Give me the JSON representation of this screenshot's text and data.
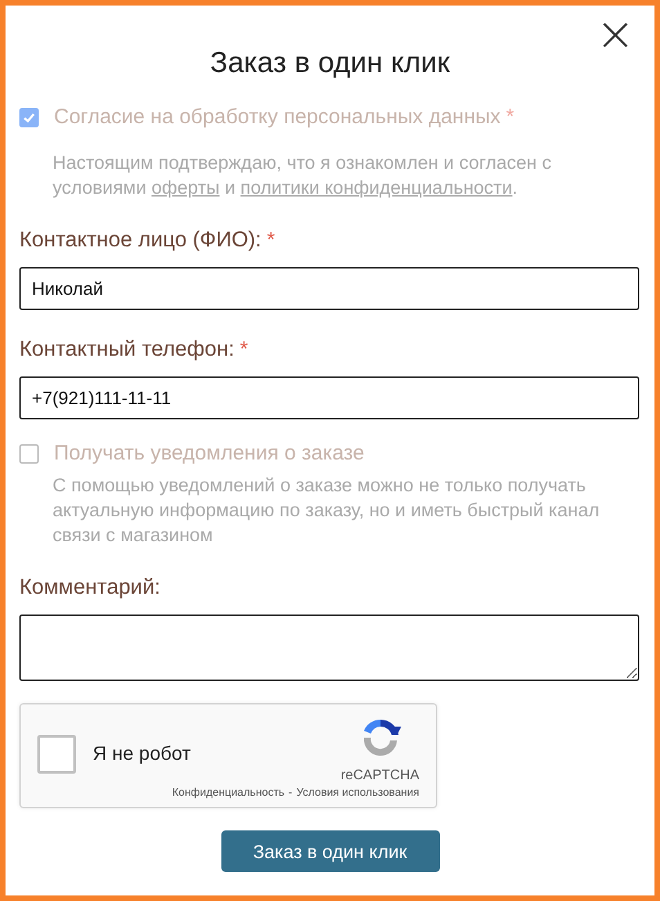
{
  "dialog": {
    "title": "Заказ в один клик",
    "close": "×"
  },
  "consent": {
    "checked": true,
    "label": "Согласие на обработку персональных данных",
    "required": "*",
    "text_before": "Настоящим подтверждаю, что я ознакомлен и согласен с условиями ",
    "link_1": "оферты",
    "text_middle": " и ",
    "link_2": "политики конфиденциальности",
    "text_after": "."
  },
  "fields": [
    {
      "label": "Контактное лицо (ФИО):",
      "required": "*",
      "value": "Николай",
      "kind": "input"
    },
    {
      "label": "Контактный телефон:",
      "required": "*",
      "value": "+7(921)111-11-11",
      "kind": "input"
    }
  ],
  "notifications": {
    "checked": false,
    "label": "Получать уведомления о заказе",
    "description": "С помощью уведомлений о заказе можно не только получать актуальную информацию по заказу, но и иметь быстрый канал связи с магазином"
  },
  "comment": {
    "label": "Комментарий:",
    "kind": "textarea"
  },
  "captcha": {
    "checked": false,
    "label": "Я не робот",
    "brand": "reCAPTCHA",
    "privacy_link": "Конфиденциальность",
    "separator": "-",
    "terms_link": "Условия использования"
  },
  "submit": "Заказ в один клик"
}
